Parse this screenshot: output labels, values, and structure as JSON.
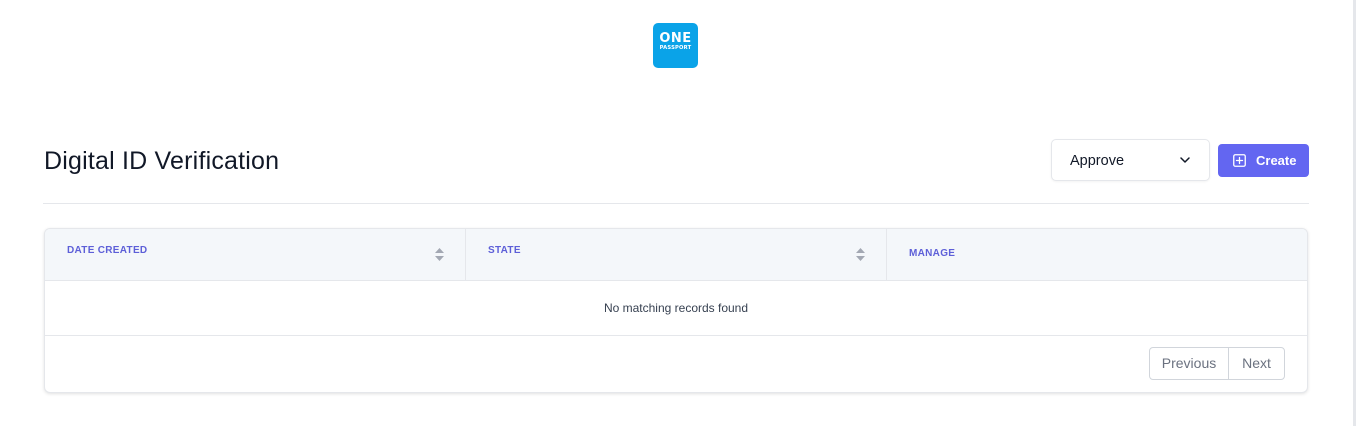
{
  "brand": {
    "logo_line1": "ONE",
    "logo_line2": "PASSPORT",
    "logo_color": "#0aa3e8"
  },
  "header": {
    "title": "Digital ID Verification",
    "filter_select": {
      "selected": "Approve",
      "icon": "chevron-down-icon"
    },
    "create_button": {
      "label": "Create",
      "icon": "plus-square-icon",
      "color": "#6366f1"
    }
  },
  "table": {
    "columns": [
      {
        "label": "DATE CREATED",
        "sortable": true,
        "icon": "sort-icon"
      },
      {
        "label": "STATE",
        "sortable": true,
        "icon": "sort-icon"
      },
      {
        "label": "MANAGE",
        "sortable": false
      }
    ],
    "rows": [],
    "empty_message": "No matching records found",
    "header_text_color": "#5d5fd8"
  },
  "pagination": {
    "previous_label": "Previous",
    "next_label": "Next"
  }
}
